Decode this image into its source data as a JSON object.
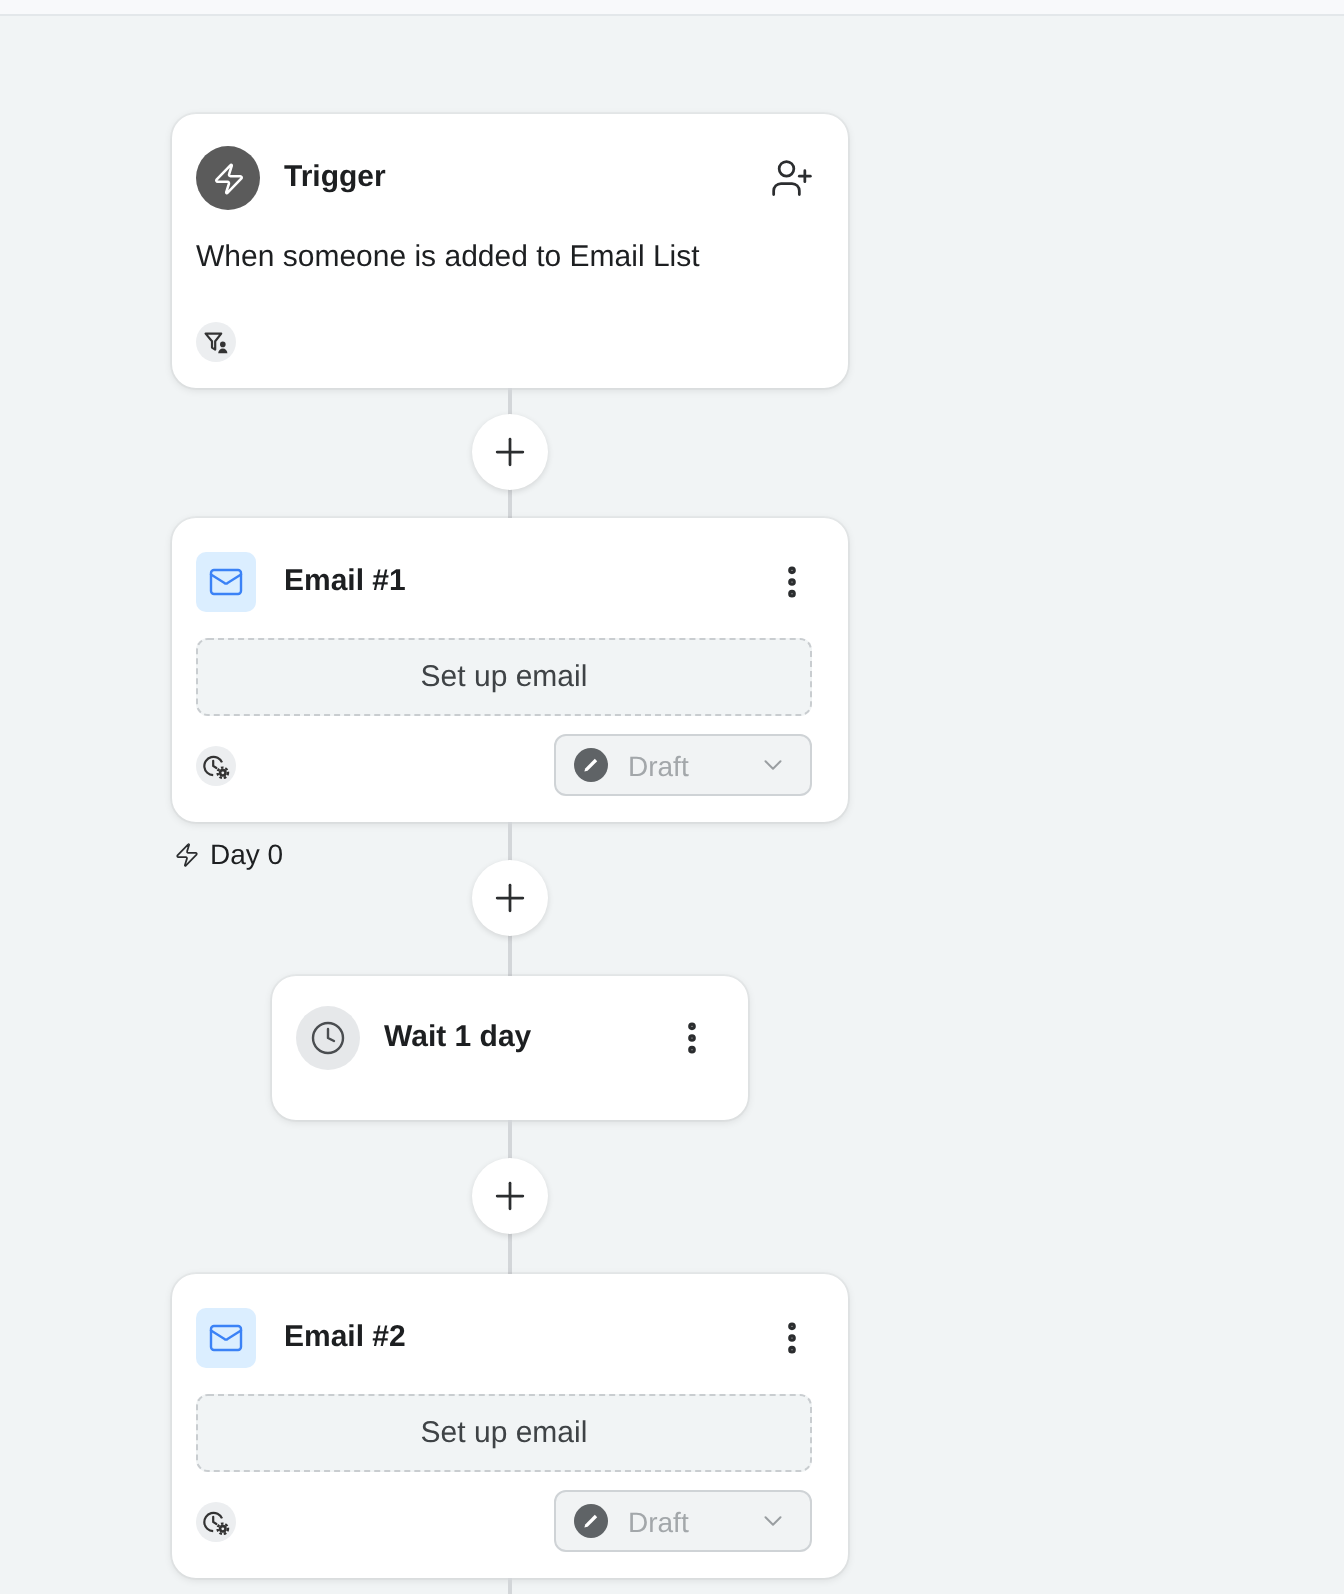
{
  "flow": [
    {
      "kind": "trigger",
      "title": "Trigger",
      "description": "When someone is added to Email List"
    },
    {
      "kind": "connector"
    },
    {
      "kind": "email",
      "title": "Email #1",
      "setup_button": "Set up email",
      "status_select": {
        "value": "Draft",
        "disabled": true
      }
    },
    {
      "kind": "connector",
      "label": "Day 0"
    },
    {
      "kind": "wait",
      "title": "Wait 1 day"
    },
    {
      "kind": "connector"
    },
    {
      "kind": "email",
      "title": "Email #2",
      "setup_button": "Set up email",
      "status_select": {
        "value": "Draft",
        "disabled": true
      }
    }
  ]
}
